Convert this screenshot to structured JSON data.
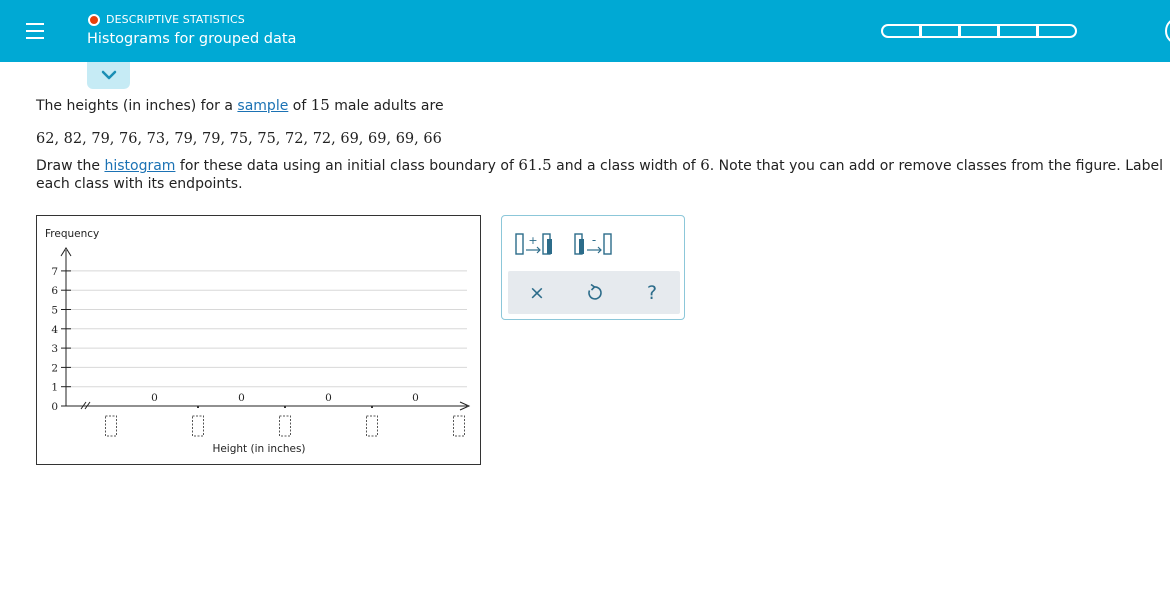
{
  "header": {
    "topic": "DESCRIPTIVE STATISTICS",
    "title": "Histograms for grouped data",
    "progress_segments": 5,
    "status_color": "#e8400c",
    "bar_color": "#00a9d4"
  },
  "question": {
    "line1_pre": "The heights (in inches) for a ",
    "line1_link": "sample",
    "line1_mid": " of ",
    "line1_num": "15",
    "line1_post": " male adults are",
    "data_values": "62, 82, 79, 76, 73, 79, 79, 75, 75, 72, 72, 69, 69, 69, 66",
    "line3_pre": "Draw the ",
    "line3_link": "histogram",
    "line3_mid1": " for these data using an initial class boundary of ",
    "line3_num1": "61.5",
    "line3_mid2": " and a class width of ",
    "line3_num2": "6",
    "line3_post": ". Note that you can add or remove classes from the figure. Label",
    "line4": "each class with its endpoints."
  },
  "graph": {
    "y_axis_label": "Frequency",
    "x_axis_label": "Height (in inches)",
    "y_ticks": [
      "0",
      "1",
      "2",
      "3",
      "4",
      "5",
      "6",
      "7"
    ],
    "bar_values": [
      "0",
      "0",
      "0",
      "0"
    ],
    "endpoint_inputs": [
      "",
      "",
      "",
      "",
      ""
    ]
  },
  "chart_data": {
    "type": "bar",
    "categories": [
      "",
      "",
      "",
      ""
    ],
    "values": [
      0,
      0,
      0,
      0
    ],
    "xlabel": "Height (in inches)",
    "ylabel": "Frequency",
    "ylim": [
      0,
      7
    ],
    "grid": true
  },
  "tools": {
    "add_class": "add-class-icon",
    "remove_class": "remove-class-icon",
    "clear": "×",
    "undo": "undo-icon",
    "help": "?"
  }
}
